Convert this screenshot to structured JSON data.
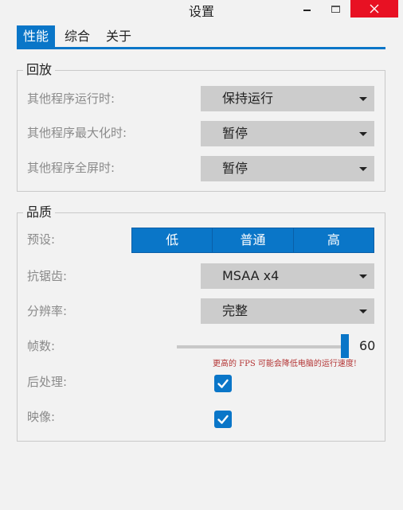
{
  "window": {
    "title": "设置",
    "close_color": "#e81123"
  },
  "tabs": [
    {
      "label": "性能",
      "active": true
    },
    {
      "label": "综合",
      "active": false
    },
    {
      "label": "关于",
      "active": false
    }
  ],
  "playback": {
    "legend": "回放",
    "rows": [
      {
        "label": "其他程序运行时:",
        "value": "保持运行"
      },
      {
        "label": "其他程序最大化时:",
        "value": "暂停"
      },
      {
        "label": "其他程序全屏时:",
        "value": "暂停"
      }
    ]
  },
  "quality": {
    "legend": "品质",
    "preset_label": "预设:",
    "preset_options": [
      "低",
      "普通",
      "高"
    ],
    "antialias_label": "抗锯齿:",
    "antialias_value": "MSAA x4",
    "resolution_label": "分辨率:",
    "resolution_value": "完整",
    "fps_label": "帧数:",
    "fps_value": "60",
    "fps_slider_fraction": 1.0,
    "fps_warning": "更高的 FPS 可能会降低电脑的运行速度!",
    "postprocess_label": "后处理:",
    "postprocess_checked": true,
    "reflection_label": "映像:",
    "reflection_checked": true
  },
  "colors": {
    "accent": "#0a76c8",
    "warning": "#b33333"
  }
}
